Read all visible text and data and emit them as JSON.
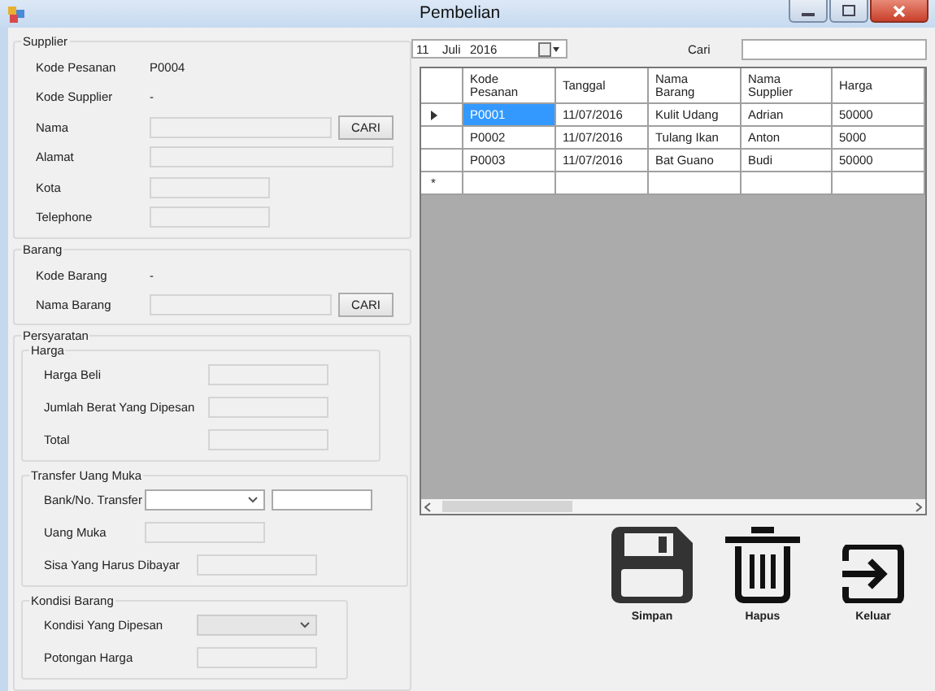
{
  "window": {
    "title": "Pembelian"
  },
  "supplier": {
    "title": "Supplier",
    "fields": [
      {
        "label": "Kode Pesanan",
        "kind": "value",
        "value": "P0004"
      },
      {
        "label": "Kode Supplier",
        "kind": "value",
        "value": "-"
      },
      {
        "label": "Nama",
        "kind": "input-button",
        "button": "CARI"
      },
      {
        "label": "Alamat",
        "kind": "input-wide"
      },
      {
        "label": "Kota",
        "kind": "input"
      },
      {
        "label": "Telephone",
        "kind": "input"
      }
    ]
  },
  "barang": {
    "title": "Barang",
    "fields": [
      {
        "label": "Kode Barang",
        "kind": "value",
        "value": "-"
      },
      {
        "label": "Nama Barang",
        "kind": "input-button",
        "button": "CARI"
      }
    ]
  },
  "persyaratan": {
    "title": "Persyaratan",
    "groups": [
      {
        "title": "Harga",
        "fields": [
          {
            "label": "Harga Beli",
            "kind": "input"
          },
          {
            "label": "Jumlah Berat Yang Dipesan",
            "kind": "input"
          },
          {
            "label": "Total",
            "kind": "input"
          }
        ]
      },
      {
        "title": "Transfer Uang Muka",
        "fields": [
          {
            "label": "Bank/No. Transfer",
            "kind": "combo-input"
          },
          {
            "label": "Uang Muka",
            "kind": "input"
          },
          {
            "label": "Sisa Yang Harus Dibayar",
            "kind": "input"
          }
        ]
      },
      {
        "title": "Kondisi Barang",
        "fields": [
          {
            "label": "Kondisi Yang Dipesan",
            "kind": "combo"
          },
          {
            "label": "Potongan Harga",
            "kind": "input"
          }
        ]
      }
    ]
  },
  "date_picker": {
    "day": "11",
    "month": "Juli",
    "year": "2016"
  },
  "search": {
    "label": "Cari"
  },
  "table": {
    "columns": [
      "Kode Pesanan",
      "Tanggal",
      "Nama Barang",
      "Nama Supplier",
      "Harga"
    ],
    "rows": [
      {
        "selected": true,
        "cells": [
          "P0001",
          "11/07/2016",
          "Kulit Udang",
          "Adrian",
          "50000"
        ]
      },
      {
        "selected": false,
        "cells": [
          "P0002",
          "11/07/2016",
          "Tulang Ikan",
          "Anton",
          "5000"
        ]
      },
      {
        "selected": false,
        "cells": [
          "P0003",
          "11/07/2016",
          "Bat Guano",
          "Budi",
          "50000"
        ]
      }
    ],
    "new_row_marker": "*"
  },
  "buttons": [
    {
      "label": "Simpan",
      "kind": "save"
    },
    {
      "label": "Hapus",
      "kind": "delete"
    },
    {
      "label": "Keluar",
      "kind": "exit"
    }
  ]
}
